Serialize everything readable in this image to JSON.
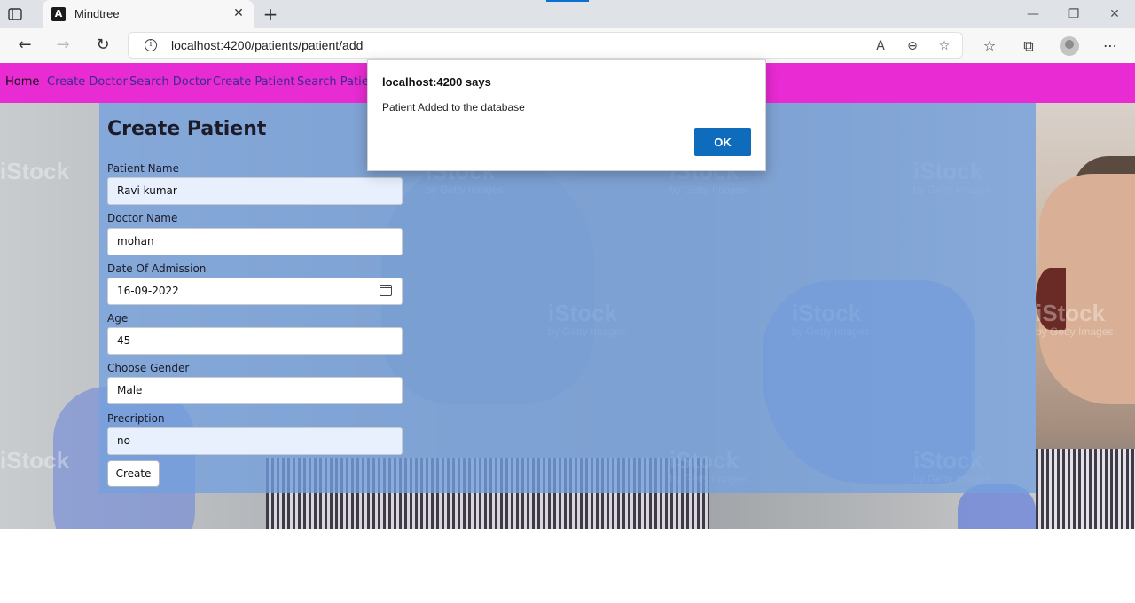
{
  "browser": {
    "tab_title": "Mindtree",
    "url": "localhost:4200/patients/patient/add",
    "new_tab": "+",
    "close_tab": "✕"
  },
  "nav": {
    "items": [
      {
        "label": "Home",
        "active": true
      },
      {
        "label": "Create Doctor"
      },
      {
        "label": "Search Doctor"
      },
      {
        "label": "Create Patient"
      },
      {
        "label": "Search Patient"
      }
    ]
  },
  "form": {
    "title": "Create Patient",
    "fields": [
      {
        "label": "Patient Name",
        "value": "Ravi kumar"
      },
      {
        "label": "Doctor Name",
        "value": "mohan"
      },
      {
        "label": "Date Of Admission",
        "value": "16-09-2022"
      },
      {
        "label": "Age",
        "value": "45"
      },
      {
        "label": "Choose Gender",
        "value": "Male"
      },
      {
        "label": "Precription",
        "value": "no"
      }
    ],
    "submit_label": "Create"
  },
  "background": {
    "watermark_brand": "iStock",
    "watermark_sub": "by Getty Images"
  },
  "dialog": {
    "title": "localhost:4200 says",
    "message": "Patient Added to the database",
    "ok_label": "OK"
  },
  "colors": {
    "nav_bg": "#e82bd2",
    "overlay": "#73a0de",
    "ok_button": "#0f6cbd"
  }
}
